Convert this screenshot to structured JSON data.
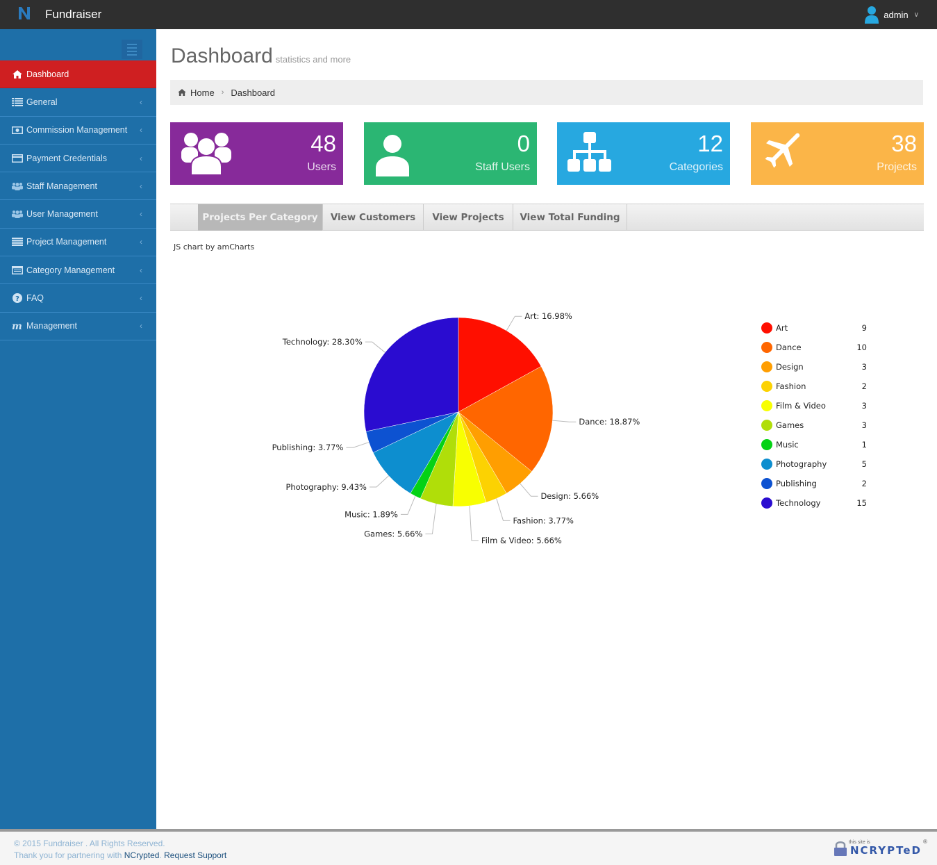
{
  "header": {
    "app_title": "Fundraiser",
    "user_name": "admin"
  },
  "sidebar": {
    "items": [
      {
        "label": "Dashboard",
        "icon": "home-icon",
        "active": true
      },
      {
        "label": "General",
        "icon": "list-icon"
      },
      {
        "label": "Commission Management",
        "icon": "money-icon"
      },
      {
        "label": "Payment Credentials",
        "icon": "credit-card-icon"
      },
      {
        "label": "Staff Management",
        "icon": "users-icon"
      },
      {
        "label": "User Management",
        "icon": "users-icon"
      },
      {
        "label": "Project Management",
        "icon": "bars-icon"
      },
      {
        "label": "Category Management",
        "icon": "window-icon"
      },
      {
        "label": "FAQ",
        "icon": "question-circle-icon"
      },
      {
        "label": "Management",
        "icon": "m-icon"
      }
    ]
  },
  "page": {
    "title": "Dashboard",
    "subtitle": "statistics and more"
  },
  "breadcrumb": {
    "home": "Home",
    "current": "Dashboard"
  },
  "stats": [
    {
      "value": "48",
      "label": "Users",
      "color": "#872a9a",
      "icon": "users-icon"
    },
    {
      "value": "0",
      "label": "Staff Users",
      "color": "#2bb673",
      "icon": "user-icon"
    },
    {
      "value": "12",
      "label": "Categories",
      "color": "#27a8e0",
      "icon": "sitemap-icon"
    },
    {
      "value": "38",
      "label": "Projects",
      "color": "#fbb548",
      "icon": "plane-icon"
    }
  ],
  "tabs": [
    {
      "label": "Projects Per Category",
      "active": true
    },
    {
      "label": "View Customers"
    },
    {
      "label": "View Projects"
    },
    {
      "label": "View Total Funding"
    }
  ],
  "chart_credit": "JS chart by amCharts",
  "chart_data": {
    "type": "pie",
    "title": "Projects Per Category",
    "categories": [
      "Art",
      "Dance",
      "Design",
      "Fashion",
      "Film & Video",
      "Games",
      "Music",
      "Photography",
      "Publishing",
      "Technology"
    ],
    "values": [
      9,
      10,
      3,
      2,
      3,
      3,
      1,
      5,
      2,
      15
    ],
    "percent_labels": [
      "16.98%",
      "18.87%",
      "5.66%",
      "3.77%",
      "5.66%",
      "5.66%",
      "1.89%",
      "9.43%",
      "3.77%",
      "28.30%"
    ],
    "colors": [
      "#ff0f00",
      "#ff6600",
      "#ff9e01",
      "#fcd202",
      "#f8ff01",
      "#b0de09",
      "#04d215",
      "#0d8ecf",
      "#0d52d1",
      "#2a0cd0"
    ],
    "legend_position": "right",
    "start_angle_deg": 90,
    "direction": "clockwise"
  },
  "footer": {
    "copyright": "© 2015 Fundraiser . All Rights Reserved.",
    "thanks_prefix": "Thank you for partnering with ",
    "partner_link": "NCrypted",
    "support_link": "Request Support",
    "badge_small": "this site is",
    "badge_big": "NCRYPTeD",
    "badge_reg": "®"
  }
}
